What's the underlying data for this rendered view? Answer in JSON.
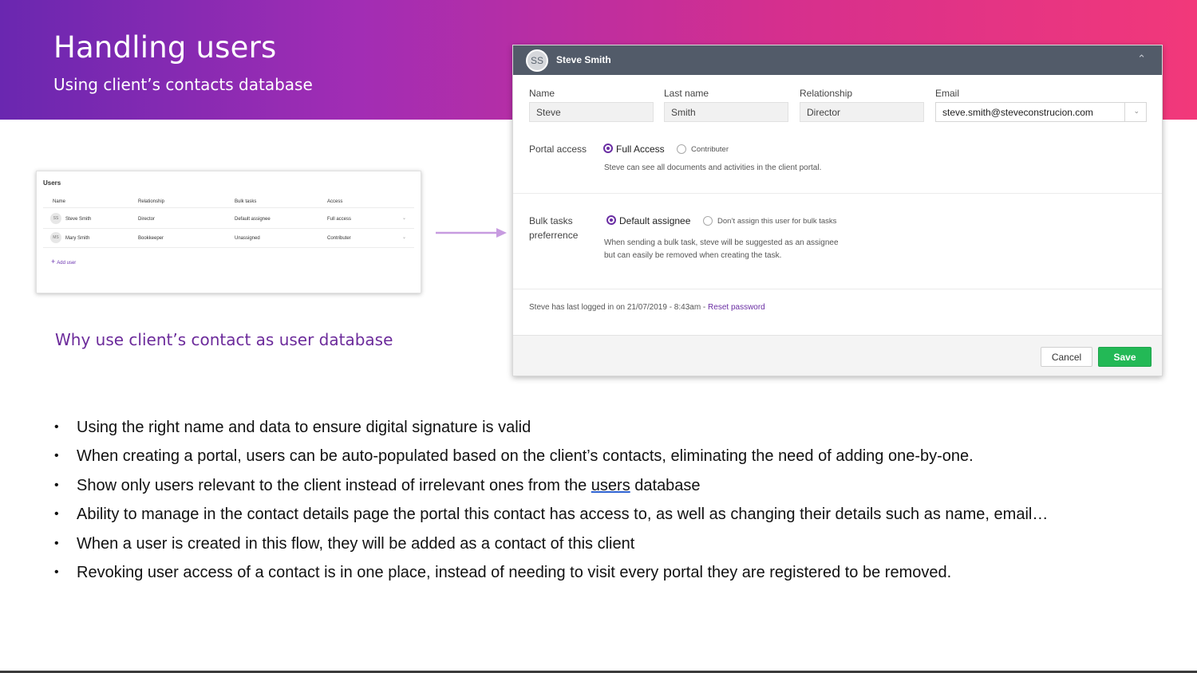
{
  "slide": {
    "title": "Handling users",
    "subtitle": "Using client’s contacts database",
    "why_heading": "Why use client’s contact as user database"
  },
  "users_table": {
    "title": "Users",
    "columns": [
      "Name",
      "Relationship",
      "Bulk tasks",
      "Access"
    ],
    "rows": [
      {
        "initials": "SS",
        "name": "Steve Smith",
        "relationship": "Director",
        "bulk": "Default assignee",
        "access": "Full access"
      },
      {
        "initials": "MS",
        "name": "Mary Smith",
        "relationship": "Bookkeeper",
        "bulk": "Unassigned",
        "access": "Contributer"
      }
    ],
    "add_label": "Add user"
  },
  "panel": {
    "avatar_initials": "SS",
    "header_name": "Steve Smith",
    "fields": {
      "name_label": "Name",
      "name_value": "Steve",
      "last_label": "Last name",
      "last_value": "Smith",
      "rel_label": "Relationship",
      "rel_value": "Director",
      "email_label": "Email",
      "email_value": "steve.smith@steveconstrucion.com"
    },
    "portal": {
      "label": "Portal access",
      "option_on": "Full Access",
      "option_off": "Contributer",
      "help": "Steve can see all documents and activities in the client portal."
    },
    "bulk": {
      "label_line1": "Bulk tasks",
      "label_line2": "preferrence",
      "option_on": "Default assignee",
      "option_off": "Don’t assign this user for bulk tasks",
      "help": "When sending a bulk task, steve will be suggested as an assignee but can easily be removed when creating the task."
    },
    "login_note": "Steve has last logged in on 21/07/2019 - 8:43am - ",
    "reset_link": "Reset password",
    "cancel": "Cancel",
    "save": "Save"
  },
  "bullets": {
    "b1": "Using the right name and data to ensure digital signature is valid",
    "b2": "When creating a portal, users can be auto-populated based on the client’s contacts, eliminating the need of adding one-by-one.",
    "b3_pre": "Show only users relevant to the client instead of irrelevant ones from the ",
    "b3_link": "users",
    "b3_post": " database",
    "b4": "Ability to manage in the contact details page the portal this contact has access to, as well as changing their details such as name, email…",
    "b5": "When a user is created in this flow, they will be added as a contact of this client",
    "b6": "Revoking user access of a contact is in one place, instead of needing to visit every portal they are registered to be removed."
  },
  "colors": {
    "accent_purple": "#6a2ea3",
    "save_green": "#23b956",
    "header_gray": "#525b69"
  }
}
